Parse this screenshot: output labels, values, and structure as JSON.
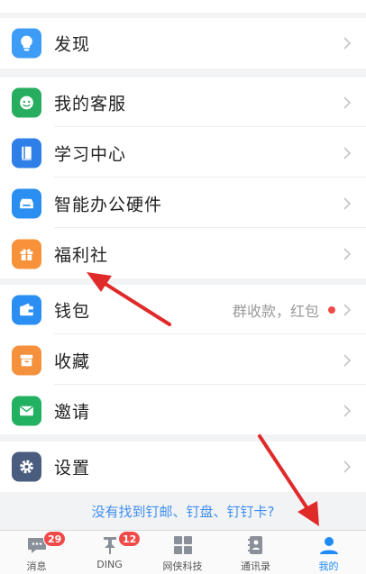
{
  "menu": {
    "discover": "发现",
    "service": "我的客服",
    "study": "学习中心",
    "hardware": "智能办公硬件",
    "welfare": "福利社",
    "wallet": "钱包",
    "wallet_hint": "群收款，红包",
    "favorites": "收藏",
    "invite": "邀请",
    "settings": "设置"
  },
  "hint_link": "没有找到钉邮、钉盘、钉钉卡?",
  "tabs": [
    {
      "label": "消息",
      "icon": "chat-icon",
      "badge": "29"
    },
    {
      "label": "DING",
      "icon": "pin-icon",
      "badge": "12"
    },
    {
      "label": "网侠科技",
      "icon": "grid-icon"
    },
    {
      "label": "通讯录",
      "icon": "contacts-icon"
    },
    {
      "label": "我的",
      "icon": "person-icon",
      "active": true
    }
  ],
  "colors": {
    "accent": "#1f8bf4",
    "badge": "#f04a48",
    "annotation_arrow": "#e02a2a"
  }
}
